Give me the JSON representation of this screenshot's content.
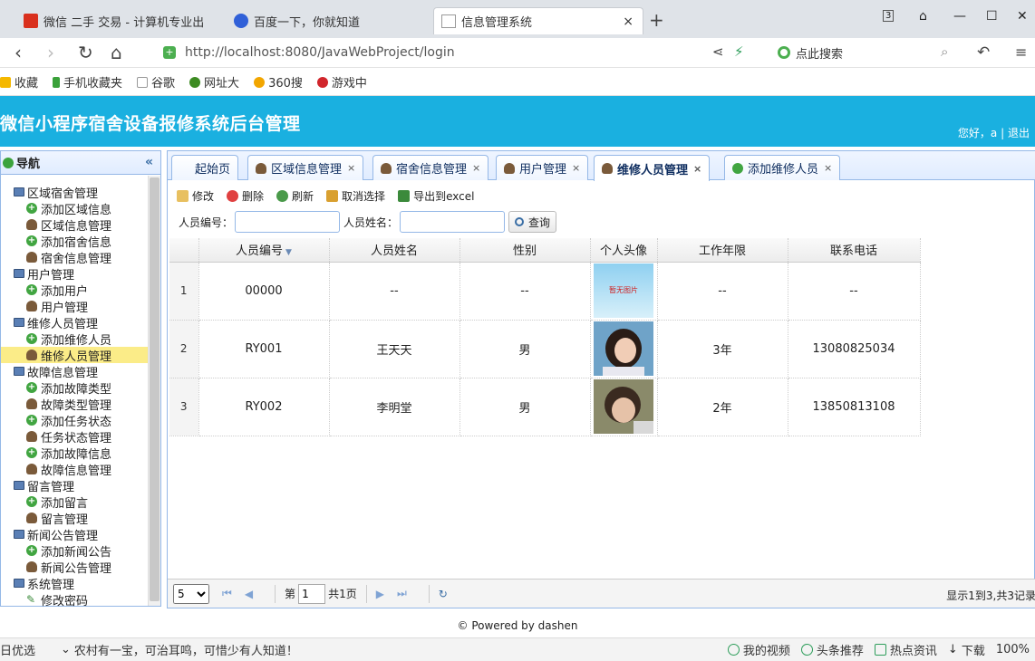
{
  "browser": {
    "tabs": [
      {
        "label": "微信 二手 交易 - 计算机专业出",
        "icon_color": "#d9301d"
      },
      {
        "label": "百度一下，你就知道",
        "icon_color": "#3060d8"
      },
      {
        "label": "信息管理系统",
        "icon_color": "#bbbbbb"
      }
    ],
    "new_tab": "+",
    "tab_count": "3",
    "url": "http://localhost:8080/JavaWebProject/login",
    "search_placeholder": "点此搜索",
    "bookmarks": [
      "收藏",
      "手机收藏夹",
      "谷歌",
      "网址大",
      "360搜",
      "游戏中"
    ]
  },
  "header": {
    "title": "微信小程序宿舍设备报修系统后台管理",
    "greeting": "您好，a",
    "logout": "退出"
  },
  "sidebar": {
    "title": "导航",
    "collapse": "«",
    "groups": [
      {
        "label": "区域宿舍管理",
        "items": [
          "添加区域信息",
          "区域信息管理",
          "添加宿舍信息",
          "宿舍信息管理"
        ]
      },
      {
        "label": "用户管理",
        "items": [
          "添加用户",
          "用户管理"
        ]
      },
      {
        "label": "维修人员管理",
        "items": [
          "添加维修人员",
          "维修人员管理"
        ]
      },
      {
        "label": "故障信息管理",
        "items": [
          "添加故障类型",
          "故障类型管理",
          "添加任务状态",
          "任务状态管理",
          "添加故障信息",
          "故障信息管理"
        ]
      },
      {
        "label": "留言管理",
        "items": [
          "添加留言",
          "留言管理"
        ]
      },
      {
        "label": "新闻公告管理",
        "items": [
          "添加新闻公告",
          "新闻公告管理"
        ]
      },
      {
        "label": "系统管理",
        "items": [
          "修改密码"
        ]
      }
    ],
    "selected": "维修人员管理"
  },
  "content_tabs": [
    {
      "label": "起始页",
      "closable": false
    },
    {
      "label": "区域信息管理",
      "closable": true
    },
    {
      "label": "宿舍信息管理",
      "closable": true
    },
    {
      "label": "用户管理",
      "closable": true
    },
    {
      "label": "维修人员管理",
      "closable": true,
      "active": true
    },
    {
      "label": "添加维修人员",
      "closable": true
    }
  ],
  "close_glyph": "×",
  "toolbar": {
    "edit": "修改",
    "delete": "删除",
    "refresh": "刷新",
    "unselect": "取消选择",
    "export": "导出到excel"
  },
  "search": {
    "id_label": "人员编号：",
    "name_label": "人员姓名：",
    "query": "查询"
  },
  "grid": {
    "columns": [
      "人员编号",
      "人员姓名",
      "性别",
      "个人头像",
      "工作年限",
      "联系电话"
    ],
    "rows": [
      {
        "num": "1",
        "id": "00000",
        "name": "--",
        "gender": "--",
        "photo": "暂无图片",
        "years": "--",
        "phone": "--"
      },
      {
        "num": "2",
        "id": "RY001",
        "name": "王天天",
        "gender": "男",
        "photo": "",
        "years": "3年",
        "phone": "13080825034"
      },
      {
        "num": "3",
        "id": "RY002",
        "name": "李明堂",
        "gender": "男",
        "photo": "",
        "years": "2年",
        "phone": "13850813108"
      }
    ]
  },
  "pager": {
    "page_size": "5",
    "page_prefix": "第",
    "page_value": "1",
    "page_total": "共1页",
    "info": "显示1到3,共3记录"
  },
  "footer": "© Powered by dashen",
  "statusbar": {
    "left": "日优选",
    "news": "农村有一宝，可治耳鸣，可惜少有人知道！",
    "items": [
      "我的视频",
      "头条推荐",
      "热点资讯",
      "下载"
    ],
    "zoom": "100%"
  }
}
